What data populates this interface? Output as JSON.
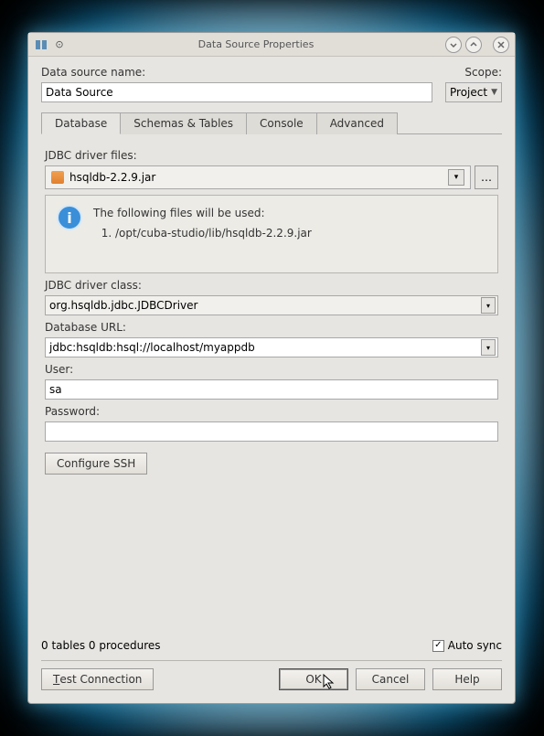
{
  "window": {
    "title": "Data Source Properties"
  },
  "form": {
    "name_label": "Data source name:",
    "name_value": "Data Source",
    "scope_label": "Scope:",
    "scope_value": "Project"
  },
  "tabs": {
    "database": "Database",
    "schemas": "Schemas & Tables",
    "console": "Console",
    "advanced": "Advanced"
  },
  "database": {
    "driver_files_label": "JDBC driver files:",
    "driver_file": "hsqldb-2.2.9.jar",
    "info_header": "The following files will be used:",
    "info_file_1": "/opt/cuba-studio/lib/hsqldb-2.2.9.jar",
    "driver_class_label": "JDBC driver class:",
    "driver_class": "org.hsqldb.jdbc.JDBCDriver",
    "url_label": "Database URL:",
    "url": "jdbc:hsqldb:hsql://localhost/myappdb",
    "user_label": "User:",
    "user": "sa",
    "password_label": "Password:",
    "password": "",
    "configure_ssh": "Configure SSH"
  },
  "status": {
    "text": "0 tables 0 procedures",
    "auto_sync_label": "Auto sync",
    "auto_sync_checked": true
  },
  "buttons": {
    "test": "Test Connection",
    "ok": "OK",
    "cancel": "Cancel",
    "help": "Help"
  }
}
